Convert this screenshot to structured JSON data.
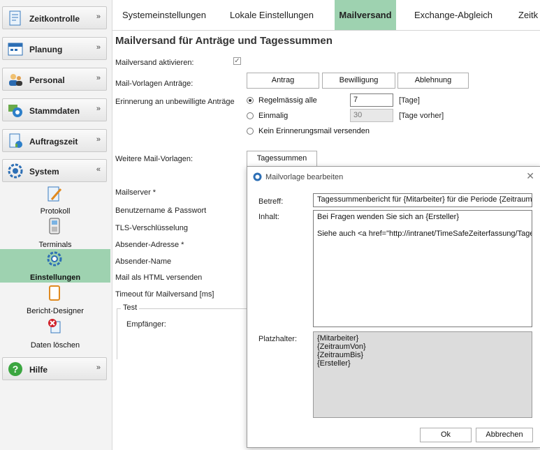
{
  "sidebar": {
    "sections": [
      {
        "label": "Zeitkontrolle",
        "icon": "document-clock-icon",
        "chevron": "»"
      },
      {
        "label": "Planung",
        "icon": "calendar-icon",
        "chevron": "»"
      },
      {
        "label": "Personal",
        "icon": "people-icon",
        "chevron": "»"
      },
      {
        "label": "Stammdaten",
        "icon": "master-data-icon",
        "chevron": "»"
      },
      {
        "label": "Auftragszeit",
        "icon": "order-time-icon",
        "chevron": "»"
      },
      {
        "label": "System",
        "icon": "gear-icon",
        "chevron": "«"
      },
      {
        "label": "Hilfe",
        "icon": "help-icon",
        "chevron": "»"
      }
    ],
    "system_items": [
      {
        "label": "Protokoll",
        "icon": "pencil-note-icon"
      },
      {
        "label": "Terminals",
        "icon": "terminal-icon"
      },
      {
        "label": "Einstellungen",
        "icon": "gear-icon"
      },
      {
        "label": "Bericht-Designer",
        "icon": "report-designer-icon"
      },
      {
        "label": "Daten löschen",
        "icon": "delete-data-icon"
      }
    ],
    "active_color": "#9ed2b0"
  },
  "tabs": [
    "Systemeinstellungen",
    "Lokale Einstellungen",
    "Mailversand",
    "Exchange-Abgleich",
    "Zeitk"
  ],
  "active_tab": "Mailversand",
  "main": {
    "title": "Mailversand für Anträge und Tagessummen",
    "mail_active_label": "Mailversand aktivieren:",
    "mail_active_checked": "✓",
    "templates_label": "Mail-Vorlagen Anträge:",
    "template_buttons": [
      "Antrag",
      "Bewilligung",
      "Ablehnung"
    ],
    "reminder_label": "Erinnerung an unbewilligte Anträge",
    "reminder_options": [
      "Regelmässig alle",
      "Einmalig",
      "Kein Erinnerungsmail versenden"
    ],
    "reminder_regular_value": "7",
    "reminder_regular_unit": "[Tage]",
    "reminder_once_value": "30",
    "reminder_once_unit": "[Tage vorher]",
    "more_templates_label": "Weitere Mail-Vorlagen:",
    "daily_sum_button": "Tagessummen",
    "fields": [
      "Mailserver *",
      "Benutzername & Passwort",
      "TLS-Verschlüsselung",
      "Absender-Adresse *",
      "Absender-Name",
      "Mail als HTML versenden",
      "Timeout für Mailversand [ms]"
    ],
    "test_group": "Test",
    "recipient_label": "Empfänger:"
  },
  "dialog": {
    "title": "Mailvorlage bearbeiten",
    "close": "✕",
    "subject_label": "Betreff:",
    "subject_value": "Tagessummenbericht für {Mitarbeiter} für die Periode {Zeitraum...",
    "content_label": "Inhalt:",
    "content_lines": [
      "Bei Fragen wenden Sie sich an {Ersteller}",
      "",
      "Siehe auch <a href=\"http://intranet/TimeSafeZeiterfassung/Tages..."
    ],
    "placeholders_label": "Platzhalter:",
    "placeholders": [
      "{Mitarbeiter}",
      "{ZeitraumVon}",
      "{ZeitraumBis}",
      "{Ersteller}"
    ],
    "ok": "Ok",
    "cancel": "Abbrechen"
  }
}
